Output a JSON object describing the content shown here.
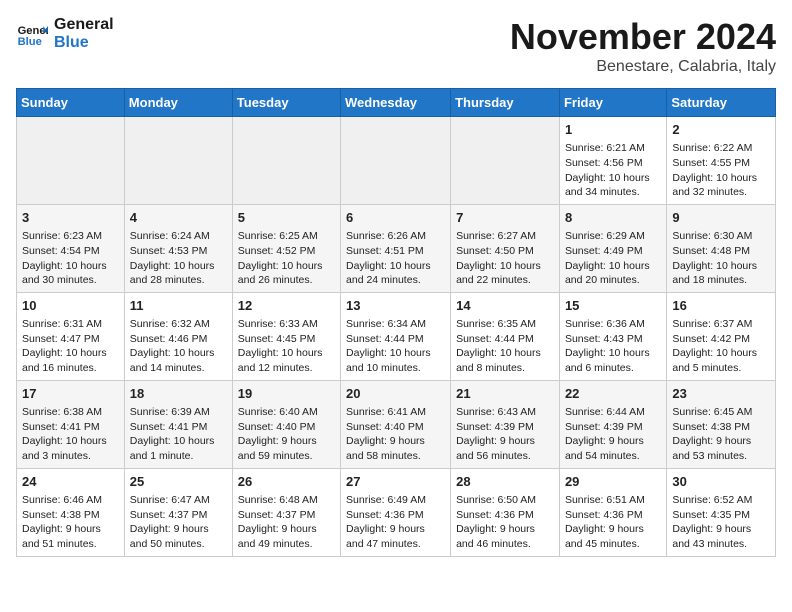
{
  "logo": {
    "line1": "General",
    "line2": "Blue"
  },
  "title": "November 2024",
  "subtitle": "Benestare, Calabria, Italy",
  "days_of_week": [
    "Sunday",
    "Monday",
    "Tuesday",
    "Wednesday",
    "Thursday",
    "Friday",
    "Saturday"
  ],
  "weeks": [
    [
      {
        "day": "",
        "content": ""
      },
      {
        "day": "",
        "content": ""
      },
      {
        "day": "",
        "content": ""
      },
      {
        "day": "",
        "content": ""
      },
      {
        "day": "",
        "content": ""
      },
      {
        "day": "1",
        "content": "Sunrise: 6:21 AM\nSunset: 4:56 PM\nDaylight: 10 hours\nand 34 minutes."
      },
      {
        "day": "2",
        "content": "Sunrise: 6:22 AM\nSunset: 4:55 PM\nDaylight: 10 hours\nand 32 minutes."
      }
    ],
    [
      {
        "day": "3",
        "content": "Sunrise: 6:23 AM\nSunset: 4:54 PM\nDaylight: 10 hours\nand 30 minutes."
      },
      {
        "day": "4",
        "content": "Sunrise: 6:24 AM\nSunset: 4:53 PM\nDaylight: 10 hours\nand 28 minutes."
      },
      {
        "day": "5",
        "content": "Sunrise: 6:25 AM\nSunset: 4:52 PM\nDaylight: 10 hours\nand 26 minutes."
      },
      {
        "day": "6",
        "content": "Sunrise: 6:26 AM\nSunset: 4:51 PM\nDaylight: 10 hours\nand 24 minutes."
      },
      {
        "day": "7",
        "content": "Sunrise: 6:27 AM\nSunset: 4:50 PM\nDaylight: 10 hours\nand 22 minutes."
      },
      {
        "day": "8",
        "content": "Sunrise: 6:29 AM\nSunset: 4:49 PM\nDaylight: 10 hours\nand 20 minutes."
      },
      {
        "day": "9",
        "content": "Sunrise: 6:30 AM\nSunset: 4:48 PM\nDaylight: 10 hours\nand 18 minutes."
      }
    ],
    [
      {
        "day": "10",
        "content": "Sunrise: 6:31 AM\nSunset: 4:47 PM\nDaylight: 10 hours\nand 16 minutes."
      },
      {
        "day": "11",
        "content": "Sunrise: 6:32 AM\nSunset: 4:46 PM\nDaylight: 10 hours\nand 14 minutes."
      },
      {
        "day": "12",
        "content": "Sunrise: 6:33 AM\nSunset: 4:45 PM\nDaylight: 10 hours\nand 12 minutes."
      },
      {
        "day": "13",
        "content": "Sunrise: 6:34 AM\nSunset: 4:44 PM\nDaylight: 10 hours\nand 10 minutes."
      },
      {
        "day": "14",
        "content": "Sunrise: 6:35 AM\nSunset: 4:44 PM\nDaylight: 10 hours\nand 8 minutes."
      },
      {
        "day": "15",
        "content": "Sunrise: 6:36 AM\nSunset: 4:43 PM\nDaylight: 10 hours\nand 6 minutes."
      },
      {
        "day": "16",
        "content": "Sunrise: 6:37 AM\nSunset: 4:42 PM\nDaylight: 10 hours\nand 5 minutes."
      }
    ],
    [
      {
        "day": "17",
        "content": "Sunrise: 6:38 AM\nSunset: 4:41 PM\nDaylight: 10 hours\nand 3 minutes."
      },
      {
        "day": "18",
        "content": "Sunrise: 6:39 AM\nSunset: 4:41 PM\nDaylight: 10 hours\nand 1 minute."
      },
      {
        "day": "19",
        "content": "Sunrise: 6:40 AM\nSunset: 4:40 PM\nDaylight: 9 hours\nand 59 minutes."
      },
      {
        "day": "20",
        "content": "Sunrise: 6:41 AM\nSunset: 4:40 PM\nDaylight: 9 hours\nand 58 minutes."
      },
      {
        "day": "21",
        "content": "Sunrise: 6:43 AM\nSunset: 4:39 PM\nDaylight: 9 hours\nand 56 minutes."
      },
      {
        "day": "22",
        "content": "Sunrise: 6:44 AM\nSunset: 4:39 PM\nDaylight: 9 hours\nand 54 minutes."
      },
      {
        "day": "23",
        "content": "Sunrise: 6:45 AM\nSunset: 4:38 PM\nDaylight: 9 hours\nand 53 minutes."
      }
    ],
    [
      {
        "day": "24",
        "content": "Sunrise: 6:46 AM\nSunset: 4:38 PM\nDaylight: 9 hours\nand 51 minutes."
      },
      {
        "day": "25",
        "content": "Sunrise: 6:47 AM\nSunset: 4:37 PM\nDaylight: 9 hours\nand 50 minutes."
      },
      {
        "day": "26",
        "content": "Sunrise: 6:48 AM\nSunset: 4:37 PM\nDaylight: 9 hours\nand 49 minutes."
      },
      {
        "day": "27",
        "content": "Sunrise: 6:49 AM\nSunset: 4:36 PM\nDaylight: 9 hours\nand 47 minutes."
      },
      {
        "day": "28",
        "content": "Sunrise: 6:50 AM\nSunset: 4:36 PM\nDaylight: 9 hours\nand 46 minutes."
      },
      {
        "day": "29",
        "content": "Sunrise: 6:51 AM\nSunset: 4:36 PM\nDaylight: 9 hours\nand 45 minutes."
      },
      {
        "day": "30",
        "content": "Sunrise: 6:52 AM\nSunset: 4:35 PM\nDaylight: 9 hours\nand 43 minutes."
      }
    ]
  ]
}
